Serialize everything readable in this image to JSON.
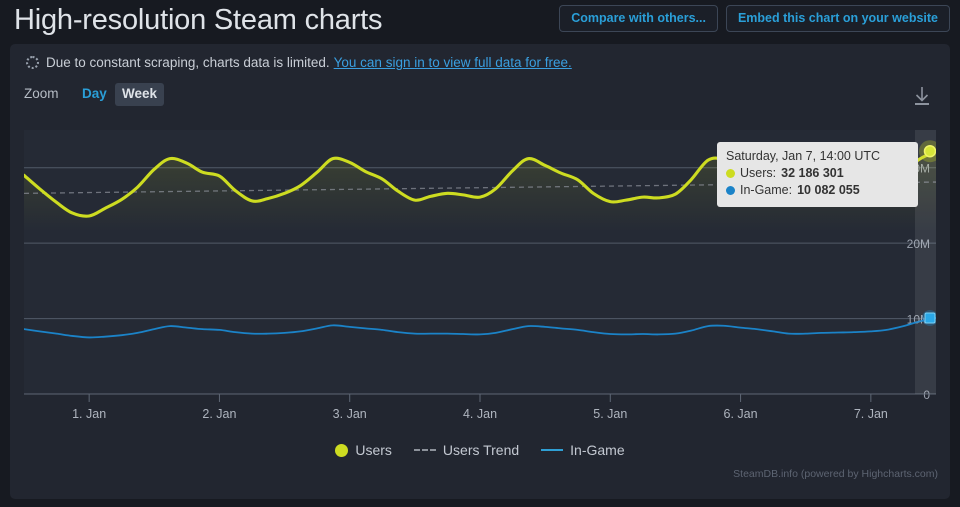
{
  "header": {
    "title": "High-resolution Steam charts",
    "buttons": [
      {
        "label": "Compare with others...",
        "name": "compare-with-others-button"
      },
      {
        "label": "Embed this chart on your website",
        "name": "embed-chart-button"
      }
    ]
  },
  "notice": {
    "icon": "spinner-icon",
    "text": "Due to constant scraping, charts data is limited.",
    "link_text": "You can sign in to view full data for free."
  },
  "zoom": {
    "label": "Zoom",
    "options": [
      {
        "label": "Day",
        "selected": false
      },
      {
        "label": "Week",
        "selected": true
      }
    ],
    "download_icon": "download-icon"
  },
  "tooltip": {
    "date": "Saturday, Jan 7, 14:00 UTC",
    "rows": [
      {
        "series": "Users",
        "label": "Users:",
        "value": "32 186 301",
        "color": "#cddc21"
      },
      {
        "series": "In-Game",
        "label": "In-Game:",
        "value": "10 082 055",
        "color": "#1b83c8"
      }
    ]
  },
  "legend": [
    {
      "label": "Users",
      "marker": "dot",
      "color": "#cddc21"
    },
    {
      "label": "Users Trend",
      "marker": "dashed-line",
      "color": "#8d929b"
    },
    {
      "label": "In-Game",
      "marker": "line",
      "color": "#2f9fd4"
    }
  ],
  "credits": "SteamDB.info (powered by Highcharts.com)",
  "colors": {
    "page_background": "#171a21",
    "panel_background": "#222630",
    "accent_link": "#2a9fd8",
    "users": "#cddc21",
    "ingame": "#1b83c8",
    "trend": "#8d929b",
    "gridline": "#5b6472"
  },
  "chart_data": {
    "type": "line",
    "title": "",
    "xlabel": "",
    "ylabel": "",
    "ylim": [
      0,
      35000000
    ],
    "grid": true,
    "legend_position": "bottom",
    "y_ticks": [
      {
        "value": 0,
        "label": "0"
      },
      {
        "value": 10000000,
        "label": "10M"
      },
      {
        "value": 20000000,
        "label": "20M"
      },
      {
        "value": 30000000,
        "label": "30M"
      }
    ],
    "x_ticks": [
      "1. Jan",
      "2. Jan",
      "3. Jan",
      "4. Jan",
      "5. Jan",
      "6. Jan",
      "7. Jan"
    ],
    "x_unit": "day-of-january-2023",
    "highlight": {
      "date": "Saturday, Jan 7, 14:00 UTC",
      "users": 32186301,
      "ingame": 10082055
    },
    "series": [
      {
        "name": "Users",
        "color": "#cddc21",
        "x": [
          0.0,
          0.12,
          0.25,
          0.37,
          0.5,
          0.62,
          0.75,
          0.87,
          1.0,
          1.12,
          1.25,
          1.37,
          1.5,
          1.62,
          1.75,
          1.87,
          2.0,
          2.12,
          2.25,
          2.37,
          2.5,
          2.62,
          2.75,
          2.87,
          3.0,
          3.12,
          3.25,
          3.37,
          3.5,
          3.62,
          3.75,
          3.87,
          4.0,
          4.12,
          4.25,
          4.37,
          4.5,
          4.62,
          4.75,
          4.87,
          5.0,
          5.12,
          5.25,
          5.37,
          5.5,
          5.62,
          5.75,
          5.87,
          6.0,
          6.12,
          6.25,
          6.37,
          6.5,
          6.62,
          6.75,
          6.87,
          7.0
        ],
        "values": [
          29000000,
          27200000,
          25400000,
          24000000,
          23600000,
          24600000,
          25800000,
          27400000,
          29800000,
          31200000,
          30600000,
          29400000,
          28900000,
          27000000,
          25600000,
          25900000,
          26600000,
          27600000,
          29400000,
          31200000,
          30700000,
          29500000,
          28500000,
          26900000,
          25700000,
          26200000,
          26600000,
          26400000,
          26100000,
          27200000,
          29600000,
          31200000,
          30300000,
          29300000,
          28400000,
          26600000,
          25500000,
          25700000,
          26100000,
          26000000,
          26500000,
          28400000,
          31000000,
          31100000,
          30000000,
          29000000,
          27400000,
          25300000,
          25500000,
          26200000,
          26300000,
          26500000,
          26900000,
          27600000,
          29400000,
          31100000,
          32186301
        ]
      },
      {
        "name": "In-Game",
        "color": "#1b83c8",
        "x": [
          0.0,
          0.12,
          0.25,
          0.37,
          0.5,
          0.62,
          0.75,
          0.87,
          1.0,
          1.12,
          1.25,
          1.37,
          1.5,
          1.62,
          1.75,
          1.87,
          2.0,
          2.12,
          2.25,
          2.37,
          2.5,
          2.62,
          2.75,
          2.87,
          3.0,
          3.12,
          3.25,
          3.37,
          3.5,
          3.62,
          3.75,
          3.87,
          4.0,
          4.12,
          4.25,
          4.37,
          4.5,
          4.62,
          4.75,
          4.87,
          5.0,
          5.12,
          5.25,
          5.37,
          5.5,
          5.62,
          5.75,
          5.87,
          6.0,
          6.12,
          6.25,
          6.37,
          6.5,
          6.62,
          6.75,
          6.87,
          7.0
        ],
        "values": [
          8600000,
          8300000,
          8000000,
          7700000,
          7500000,
          7600000,
          7800000,
          8100000,
          8600000,
          9000000,
          8800000,
          8600000,
          8500000,
          8200000,
          8000000,
          8000000,
          8100000,
          8300000,
          8700000,
          9100000,
          8900000,
          8700000,
          8500000,
          8200000,
          8000000,
          8000000,
          8000000,
          7950000,
          7900000,
          8100000,
          8600000,
          9000000,
          8900000,
          8700000,
          8500000,
          8200000,
          7950000,
          7900000,
          7950000,
          7900000,
          8000000,
          8400000,
          9000000,
          9050000,
          8800000,
          8600000,
          8300000,
          8000000,
          8000000,
          8100000,
          8150000,
          8200000,
          8300000,
          8500000,
          9000000,
          9600000,
          10082055
        ]
      },
      {
        "name": "Users Trend",
        "color": "#8d929b",
        "style": "dashed",
        "x": [
          0.0,
          7.0
        ],
        "values": [
          26600000,
          28100000
        ]
      }
    ]
  }
}
